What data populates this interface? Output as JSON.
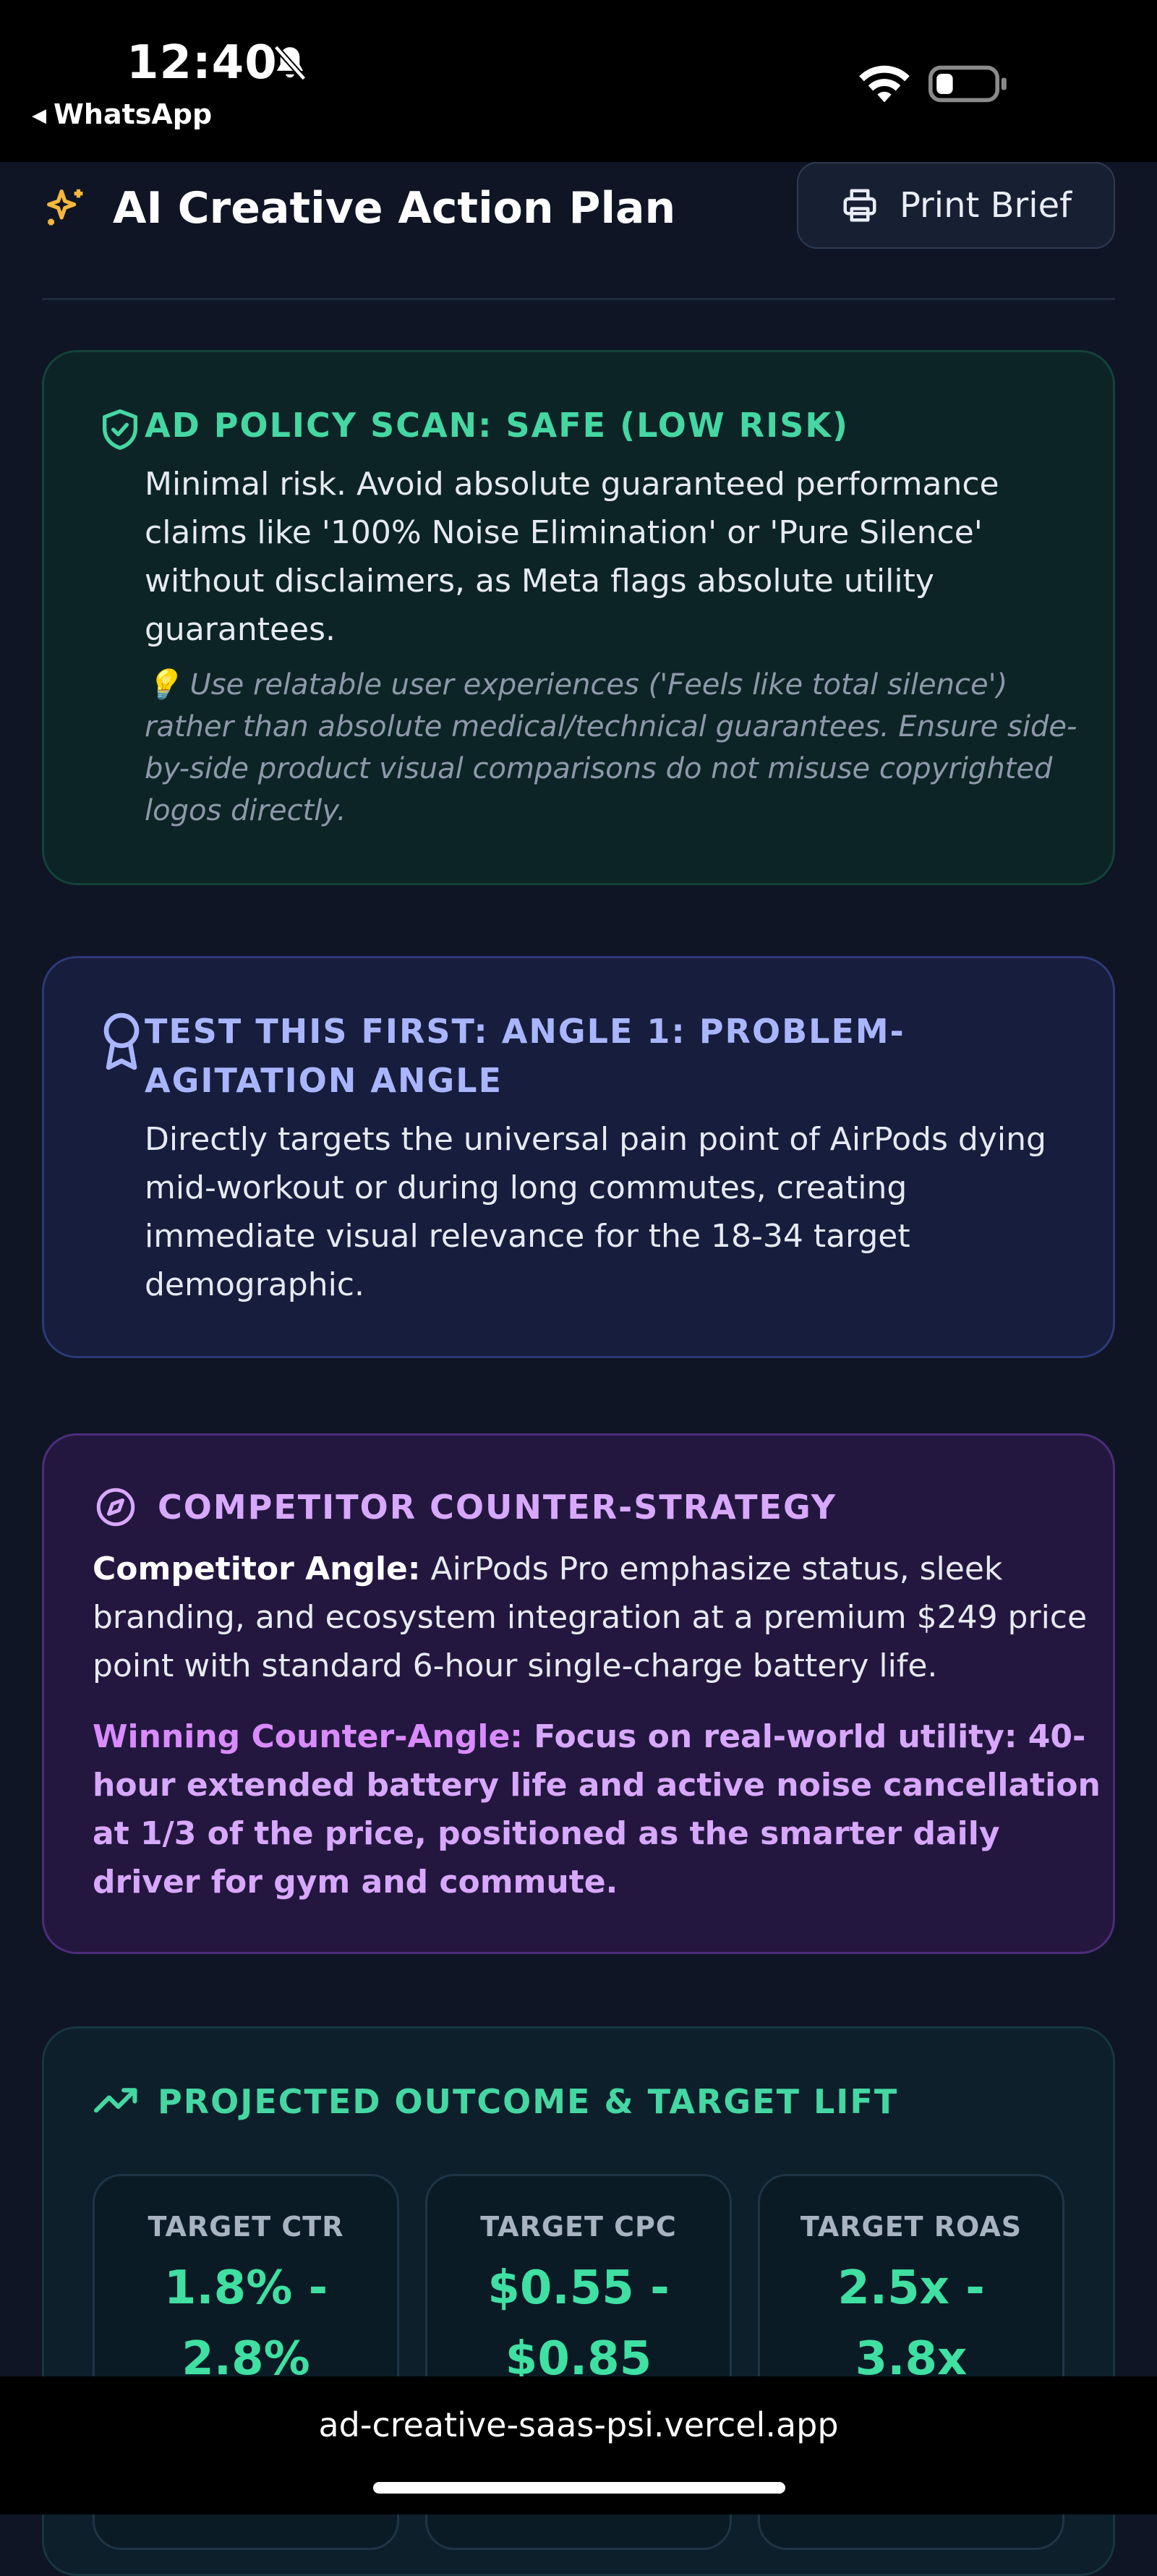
{
  "status_bar": {
    "time": "12:40",
    "back_app": "WhatsApp",
    "icons": [
      "bell-slash-icon",
      "wifi-icon",
      "battery-icon"
    ]
  },
  "header": {
    "title": "AI Creative Action Plan",
    "print_button": "Print Brief",
    "icons": [
      "sparkles-icon",
      "printer-icon"
    ]
  },
  "policy_card": {
    "heading": "AD POLICY SCAN: SAFE (LOW RISK)",
    "body": "Minimal risk. Avoid absolute guaranteed performance claims like '100% Noise Elimination' or 'Pure Silence' without disclaimers, as Meta flags absolute utility guarantees.",
    "tip": "💡  Use relatable user experiences ('Feels like total silence') rather than absolute medical/technical guarantees. Ensure side-by-side product visual comparisons do not misuse copyrighted logos directly.",
    "icon": "shield-check-icon",
    "accent": "#45d7a2"
  },
  "test_card": {
    "heading": "TEST THIS FIRST: ANGLE 1: PROBLEM-AGITATION ANGLE",
    "body": "Directly targets the universal pain point of AirPods dying mid-workout or during long commutes, creating immediate visual relevance for the 18-34 target demographic.",
    "icon": "award-ribbon-icon",
    "accent": "#a9b6ff"
  },
  "competitor_card": {
    "heading": "COMPETITOR COUNTER-STRATEGY",
    "competitor_label": "Competitor Angle:",
    "competitor_text": " AirPods Pro emphasize status, sleek branding, and ecosystem integration at a premium $249 price point with standard 6-hour single-charge battery life.",
    "winning_label": "Winning Counter-Angle:",
    "winning_text": " Focus on real-world utility: 40-hour extended battery life and active noise cancellation at 1/3 of the price, positioned as the smarter daily driver for gym and commute.",
    "icon": "compass-icon",
    "accent": "#d8a8ff"
  },
  "projection_card": {
    "heading": "PROJECTED OUTCOME & TARGET LIFT",
    "icon": "trending-up-icon",
    "metrics": [
      {
        "label": "TARGET CTR",
        "value_line1": "1.8% -",
        "value_line2": "2.8%"
      },
      {
        "label": "TARGET CPC",
        "value_line1": "$0.55 -",
        "value_line2": "$0.85"
      },
      {
        "label": "TARGET ROAS",
        "value_line1": "2.5x -",
        "value_line2": "3.8x"
      }
    ]
  },
  "browser": {
    "url": "ad-creative-saas-psi.vercel.app"
  }
}
